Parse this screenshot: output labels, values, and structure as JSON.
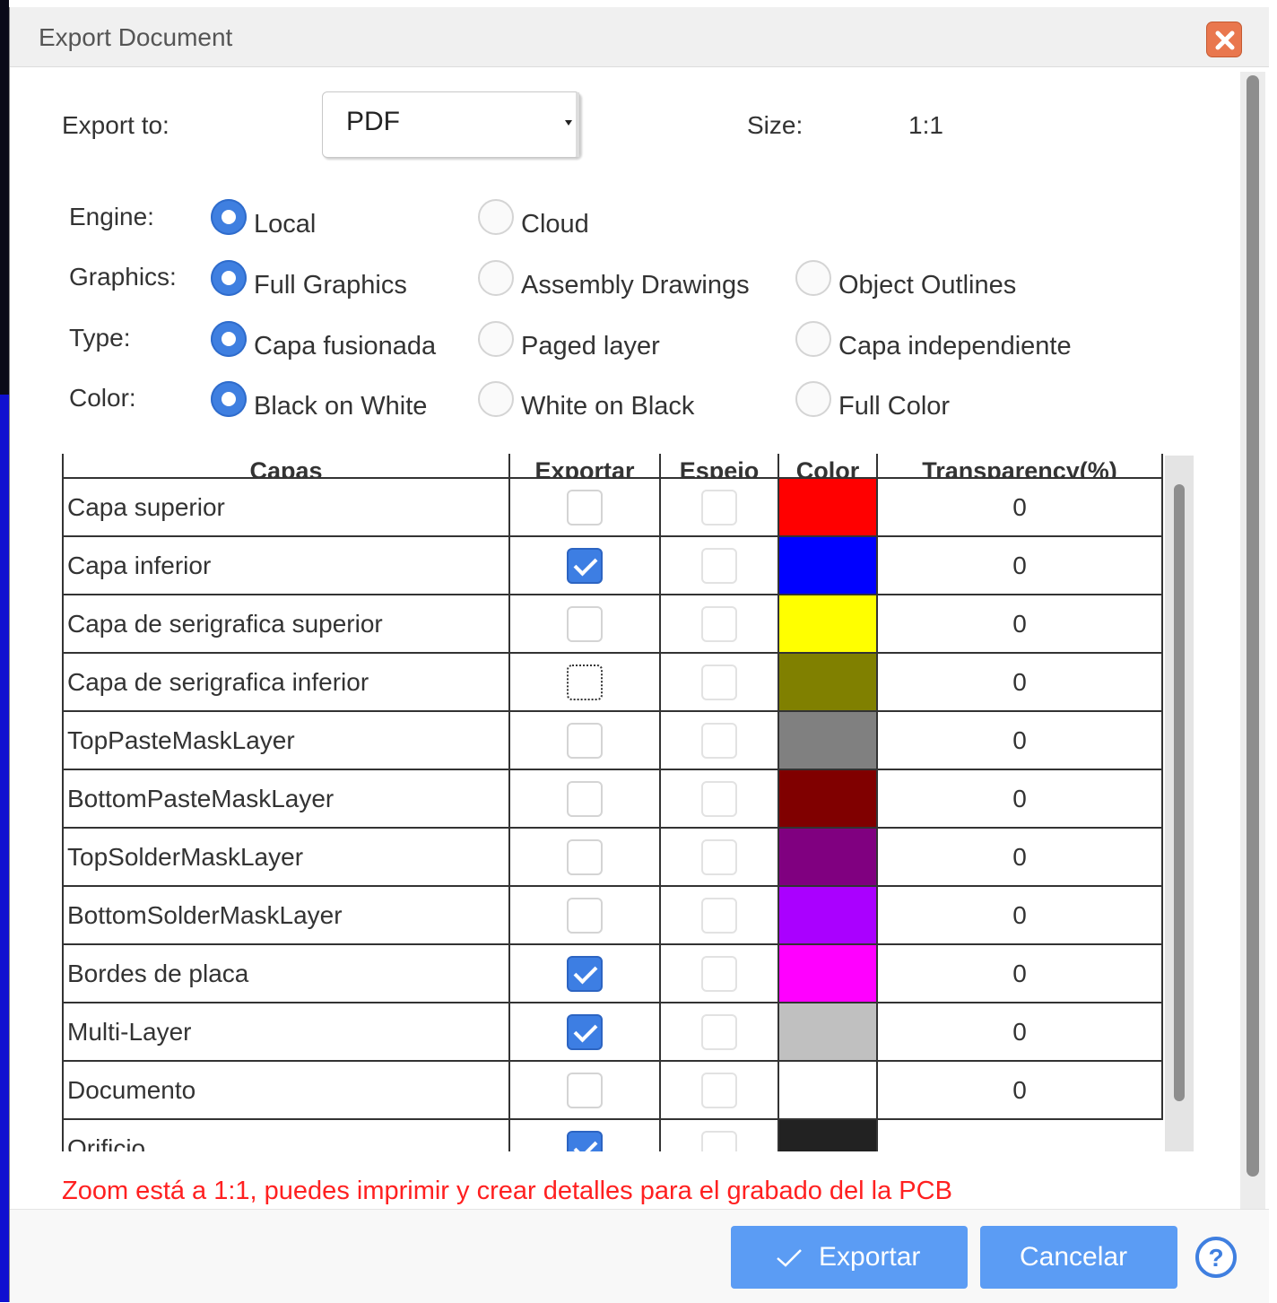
{
  "dialog": {
    "title": "Export Document"
  },
  "export_to": {
    "label": "Export to:",
    "value": "PDF"
  },
  "size": {
    "label": "Size:",
    "value": "1:1"
  },
  "engine": {
    "label": "Engine:",
    "options": [
      "Local",
      "Cloud"
    ],
    "selected": "Local"
  },
  "graphics": {
    "label": "Graphics:",
    "options": [
      "Full Graphics",
      "Assembly Drawings",
      "Object Outlines"
    ],
    "selected": "Full Graphics"
  },
  "type": {
    "label": "Type:",
    "options": [
      "Capa fusionada",
      "Paged layer",
      "Capa independiente"
    ],
    "selected": "Capa fusionada"
  },
  "color": {
    "label": "Color:",
    "options": [
      "Black on White",
      "White on Black",
      "Full Color"
    ],
    "selected": "Black on White"
  },
  "layers_table": {
    "headers": [
      "Capas",
      "Exportar",
      "Espejo",
      "Color",
      "Transparency(%)"
    ],
    "rows": [
      {
        "name": "Capa superior",
        "export": false,
        "mirror": false,
        "color": "#ff0000",
        "transparency": "0"
      },
      {
        "name": "Capa inferior",
        "export": true,
        "mirror": false,
        "color": "#0000ff",
        "transparency": "0"
      },
      {
        "name": "Capa de serigrafica superior",
        "export": false,
        "mirror": false,
        "color": "#ffff00",
        "transparency": "0"
      },
      {
        "name": "Capa de serigrafica inferior",
        "export": false,
        "mirror": false,
        "color": "#808000",
        "transparency": "0"
      },
      {
        "name": "TopPasteMaskLayer",
        "export": false,
        "mirror": false,
        "color": "#808080",
        "transparency": "0"
      },
      {
        "name": "BottomPasteMaskLayer",
        "export": false,
        "mirror": false,
        "color": "#800000",
        "transparency": "0"
      },
      {
        "name": "TopSolderMaskLayer",
        "export": false,
        "mirror": false,
        "color": "#800080",
        "transparency": "0"
      },
      {
        "name": "BottomSolderMaskLayer",
        "export": false,
        "mirror": false,
        "color": "#aa00ff",
        "transparency": "0"
      },
      {
        "name": "Bordes de placa",
        "export": true,
        "mirror": false,
        "color": "#ff00ff",
        "transparency": "0"
      },
      {
        "name": "Multi-Layer",
        "export": true,
        "mirror": false,
        "color": "#c0c0c0",
        "transparency": "0"
      },
      {
        "name": "Documento",
        "export": false,
        "mirror": false,
        "color": "#ffffff",
        "transparency": "0"
      },
      {
        "name": "Orificio",
        "export": true,
        "mirror": false,
        "color": "#222222",
        "transparency": ""
      }
    ]
  },
  "warning": "Zoom está a 1:1, puedes imprimir y crear detalles para el grabado del la PCB",
  "buttons": {
    "export": "Exportar",
    "cancel": "Cancelar"
  }
}
